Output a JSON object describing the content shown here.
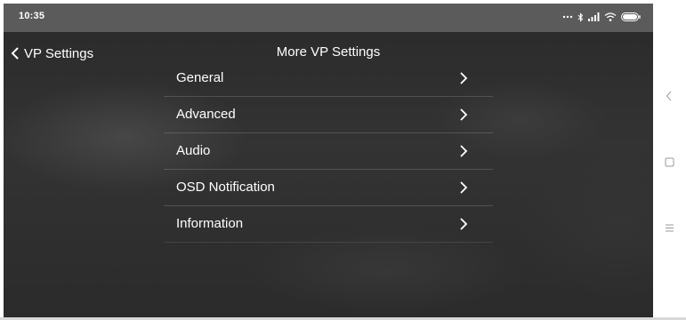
{
  "status_bar": {
    "time": "10:35",
    "icons": [
      "more-dots-icon",
      "bluetooth-icon",
      "signal-icon",
      "wifi-icon",
      "battery-icon"
    ]
  },
  "header": {
    "back_label": "VP Settings",
    "title": "More VP Settings"
  },
  "menu": {
    "items": [
      {
        "label": "General"
      },
      {
        "label": "Advanced"
      },
      {
        "label": "Audio"
      },
      {
        "label": "OSD Notification"
      },
      {
        "label": "Information"
      }
    ]
  },
  "system_nav": {
    "buttons": [
      "back-icon",
      "home-icon",
      "menu-icon"
    ]
  },
  "colors": {
    "status_bar_bg": "#5b5b5b",
    "text": "#ffffff",
    "background": "#2e2e2e"
  }
}
